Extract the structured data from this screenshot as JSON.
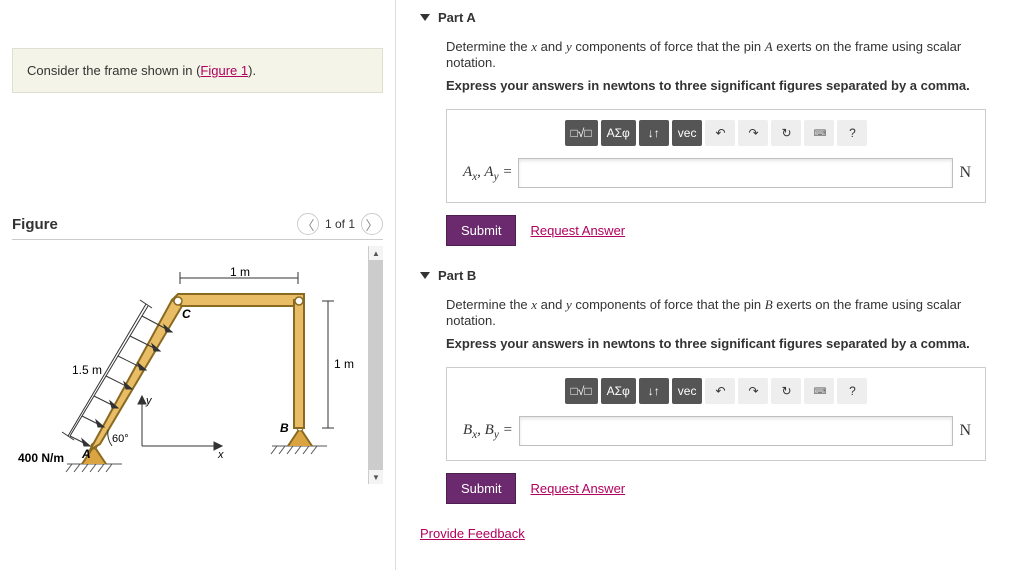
{
  "intro": {
    "prefix": "Consider the frame shown in (",
    "link": "Figure 1",
    "suffix": ")."
  },
  "figure": {
    "title": "Figure",
    "count": "1 of 1",
    "labels": {
      "top": "1 m",
      "right": "1 m",
      "left": "1.5 m",
      "angle": "60°",
      "load": "400 N/m",
      "A": "A",
      "B": "B",
      "C": "C",
      "x": "x",
      "y": "y"
    }
  },
  "toolbar": {
    "templates": "□√□",
    "greek": "ΑΣφ",
    "subsup": "↓↑",
    "vec": "vec",
    "undo": "↶",
    "redo": "↷",
    "reset": "↻",
    "keyboard": "⌨",
    "help": "?"
  },
  "partA": {
    "title": "Part A",
    "question_pre": "Determine the ",
    "q_x": "x",
    "q_mid1": " and ",
    "q_y": "y",
    "q_mid2": " components of force that the pin ",
    "q_pin": "A",
    "q_post": " exerts on the frame using scalar notation.",
    "instruction": "Express your answers in newtons to three significant figures separated by a comma.",
    "var_label_html": "Aₓ, Aᵧ =",
    "unit": "N",
    "submit": "Submit",
    "request": "Request Answer"
  },
  "partB": {
    "title": "Part B",
    "question_pre": "Determine the ",
    "q_x": "x",
    "q_mid1": " and ",
    "q_y": "y",
    "q_mid2": " components of force that the pin ",
    "q_pin": "B",
    "q_post": " exerts on the frame using scalar notation.",
    "instruction": "Express your answers in newtons to three significant figures separated by a comma.",
    "var_label_html": "Bₓ, Bᵧ =",
    "unit": "N",
    "submit": "Submit",
    "request": "Request Answer"
  },
  "feedback": "Provide Feedback"
}
